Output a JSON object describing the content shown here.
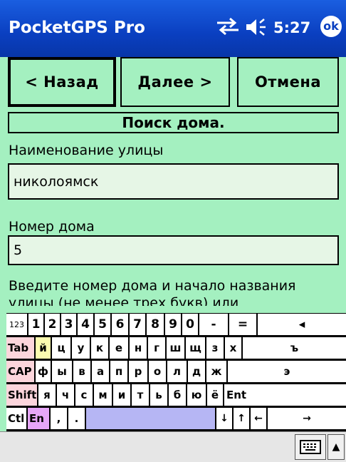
{
  "titlebar": {
    "app_title": "PocketGPS Pro",
    "time": "5:27",
    "ok_label": "ok",
    "icons": [
      "connectivity-icon",
      "volume-icon"
    ]
  },
  "nav": {
    "back_label": "< Назад",
    "next_label": "Далее >",
    "cancel_label": "Отмена"
  },
  "form": {
    "section_title": "Поиск дома.",
    "street_label": "Наименование улицы",
    "street_value": "николоямск",
    "house_label": "Номер дома",
    "house_value": "5",
    "hint_line1": "Введите номер дома и начало названия",
    "hint_line2": "улицы (не менее трех букв) или"
  },
  "keyboard": {
    "rows": [
      [
        "123",
        "1",
        "2",
        "3",
        "4",
        "5",
        "6",
        "7",
        "8",
        "9",
        "0",
        "-",
        "=",
        "◂"
      ],
      [
        "Tab",
        "й",
        "ц",
        "у",
        "к",
        "е",
        "н",
        "г",
        "ш",
        "щ",
        "з",
        "х",
        "ъ"
      ],
      [
        "CAP",
        "ф",
        "ы",
        "в",
        "а",
        "п",
        "р",
        "о",
        "л",
        "д",
        "ж",
        "э"
      ],
      [
        "Shift",
        "я",
        "ч",
        "с",
        "м",
        "и",
        "т",
        "ь",
        "б",
        "ю",
        "ё",
        "Ent"
      ],
      [
        "Ctl",
        "En",
        ",",
        ".",
        "",
        "↓",
        "↑",
        "←",
        "→"
      ]
    ]
  },
  "bottombar": {
    "keyboard_icon": "keyboard-icon",
    "menu_arrow": "▲"
  },
  "colors": {
    "titlebar": "#0a3fc0",
    "background": "#a4f0c0",
    "field": "#e6f6e6",
    "key_pink": "#fcd5dc",
    "key_blue": "#b6b6f4",
    "key_purple": "#e6a6f8",
    "key_yellow": "#fcfcb0"
  }
}
